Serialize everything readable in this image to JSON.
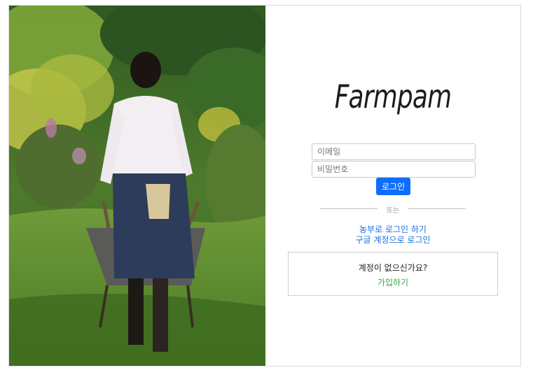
{
  "brand": {
    "logo_text": "Farmpam"
  },
  "login_form": {
    "email_placeholder": "이메일",
    "password_placeholder": "비밀번호",
    "login_button_label": "로그인",
    "accent_color": "#0d6efd"
  },
  "divider": {
    "or_text": "또는"
  },
  "alt_logins": {
    "farmer_login_label": "농부로 로그인 하기",
    "google_login_label": "구글 계정으로 로그인"
  },
  "signup": {
    "question": "계정이 없으신가요?",
    "link_label": "가입하기",
    "link_color": "#2eae3c"
  },
  "hero_image": {
    "subject": "woman-pushing-wheelbarrow-in-garden"
  }
}
